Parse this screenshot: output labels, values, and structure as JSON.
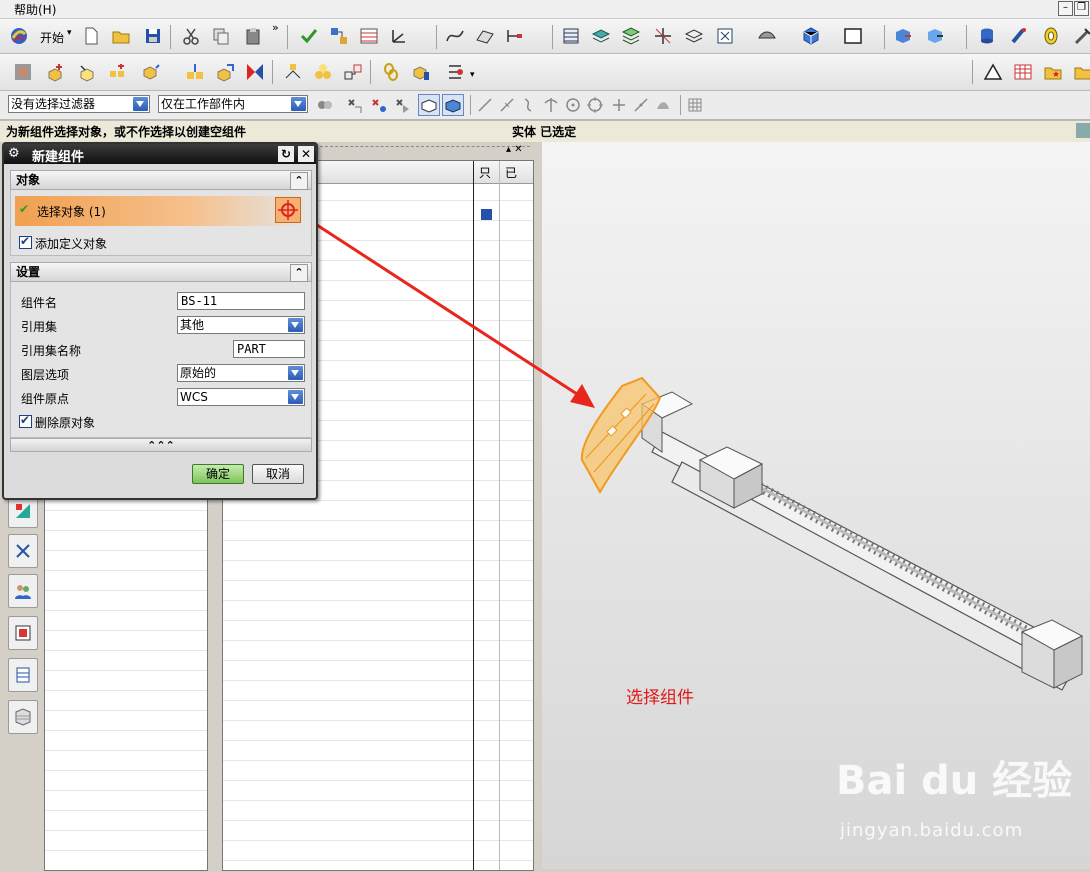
{
  "menubar": {
    "help_menu": "帮助(H)"
  },
  "toolbar": {
    "start_button": "开始"
  },
  "filters": {
    "type_filter": "没有选择过滤器",
    "scope_filter": "仅在工作部件内"
  },
  "status": {
    "prompt": "为新组件选择对象，或不作选择以创建空组件",
    "selection": "实体 已选定"
  },
  "nav": {
    "col_readonly": "只",
    "col_modified": "已"
  },
  "dialog": {
    "title": "新建组件",
    "objects_section": "对象",
    "select_objects": "选择对象 (1)",
    "add_defined_objects": "添加定义对象",
    "settings_section": "设置",
    "component_name_label": "组件名",
    "component_name_value": "BS-11",
    "reference_set_label": "引用集",
    "reference_set_value": "其他",
    "reference_set_name_label": "引用集名称",
    "reference_set_name_value": "PART",
    "layer_option_label": "图层选项",
    "layer_option_value": "原始的",
    "component_origin_label": "组件原点",
    "component_origin_value": "WCS",
    "delete_original": "删除原对象",
    "more_chevrons": "⌃⌃⌃",
    "ok_button": "确定",
    "cancel_button": "取消"
  },
  "annotation": {
    "text": "选择组件"
  },
  "watermark": {
    "logo": "Bai du 经验",
    "url": "jingyan.baidu.com"
  },
  "colors": {
    "accent_orange": "#f0a050",
    "arrow_red": "#e8261c",
    "dialog_title_bg": "#1a1a1a",
    "ok_green": "#88cc66"
  }
}
